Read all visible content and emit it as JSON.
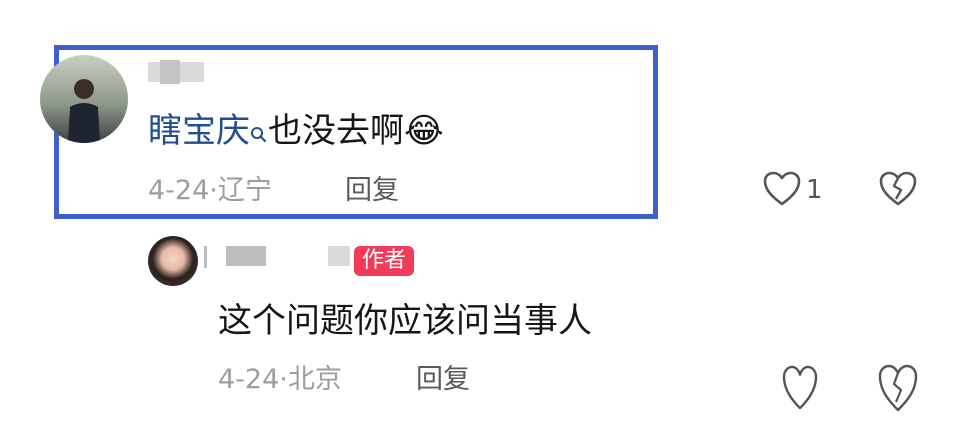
{
  "comment": {
    "mention": "瞎宝庆",
    "text": "也没去啊",
    "emoji": "😂",
    "date": "4-24",
    "location": "辽宁",
    "reply_label": "回复",
    "like_count": "1",
    "colors": {
      "highlight_border": "#3f5fd0",
      "mention": "#1f4f8f"
    }
  },
  "reply_comment": {
    "author_badge": "作者",
    "text": "这个问题你应该问当事人",
    "date": "4-24",
    "location": "北京",
    "reply_label": "回复",
    "colors": {
      "badge_bg": "#f23b58"
    }
  },
  "icons": [
    "heart-icon",
    "broken-heart-icon",
    "search-icon"
  ]
}
